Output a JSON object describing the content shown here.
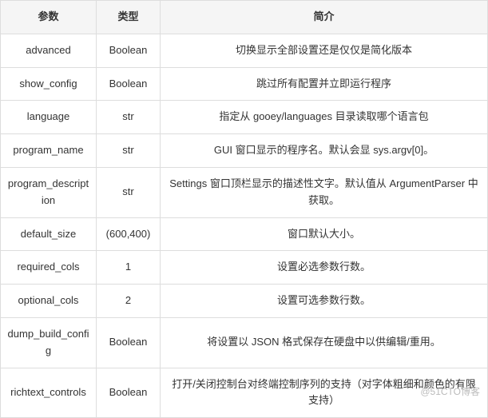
{
  "headers": {
    "param": "参数",
    "type": "类型",
    "desc": "简介"
  },
  "rows": [
    {
      "param": "advanced",
      "type": "Boolean",
      "desc": "切换显示全部设置还是仅仅是简化版本"
    },
    {
      "param": "show_config",
      "type": "Boolean",
      "desc": "跳过所有配置并立即运行程序"
    },
    {
      "param": "language",
      "type": "str",
      "desc": "指定从 gooey/languages 目录读取哪个语言包"
    },
    {
      "param": "program_name",
      "type": "str",
      "desc": "GUI 窗口显示的程序名。默认会显 sys.argv[0]。"
    },
    {
      "param": "program_description",
      "type": "str",
      "desc": "Settings 窗口顶栏显示的描述性文字。默认值从 ArgumentParser 中获取。"
    },
    {
      "param": "default_size",
      "type": "(600,400)",
      "desc": "窗口默认大小。"
    },
    {
      "param": "required_cols",
      "type": "1",
      "desc": "设置必选参数行数。"
    },
    {
      "param": "optional_cols",
      "type": "2",
      "desc": "设置可选参数行数。"
    },
    {
      "param": "dump_build_config",
      "type": "Boolean",
      "desc": "将设置以 JSON 格式保存在硬盘中以供编辑/重用。"
    },
    {
      "param": "richtext_controls",
      "type": "Boolean",
      "desc": "打开/关闭控制台对终端控制序列的支持（对字体粗细和颜色的有限支持）"
    }
  ],
  "watermark": "@51CTO博客"
}
